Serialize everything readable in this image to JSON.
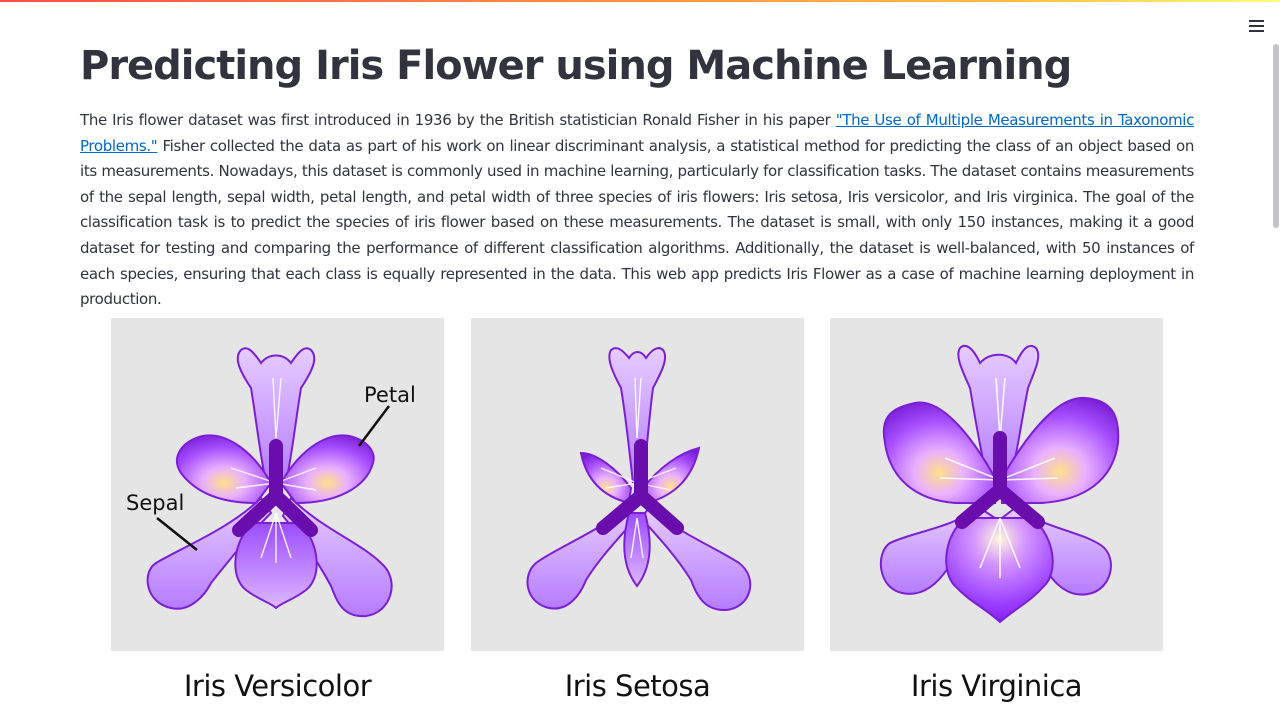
{
  "header": {
    "menu_icon": "hamburger-menu-icon"
  },
  "main": {
    "title": "Predicting Iris Flower using Machine Learning",
    "intro_before_link": "The Iris flower dataset was first introduced in 1936 by the British statistician Ronald Fisher in his paper ",
    "intro_link": "\"The Use of Multiple Measurements in Taxonomic Problems.\"",
    "intro_after_link": " Fisher collected the data as part of his work on linear discriminant analysis, a statistical method for predicting the class of an object based on its measurements. Nowadays, this dataset is commonly used in machine learning, particularly for classification tasks. The dataset contains measurements of the sepal length, sepal width, petal length, and petal width of three species of iris flowers: Iris setosa, Iris versicolor, and Iris virginica. The goal of the classification task is to predict the species of iris flower based on these measurements. The dataset is small, with only 150 instances, making it a good dataset for testing and comparing the performance of different classification algorithms. Additionally, the dataset is well-balanced, with 50 instances of each species, ensuring that each class is equally represented in the data. This web app predicts Iris Flower as a case of machine learning deployment in production."
  },
  "flowers": [
    {
      "name": "Iris Versicolor",
      "label_petal": "Petal",
      "label_sepal": "Sepal"
    },
    {
      "name": "Iris Setosa"
    },
    {
      "name": "Iris Virginica"
    }
  ],
  "colors": {
    "accent_link": "#0068c9",
    "text": "#31333f",
    "card_bg": "#e5e5e6",
    "flower_dark": "#6a0dad",
    "flower_light": "#c9a0ff"
  }
}
